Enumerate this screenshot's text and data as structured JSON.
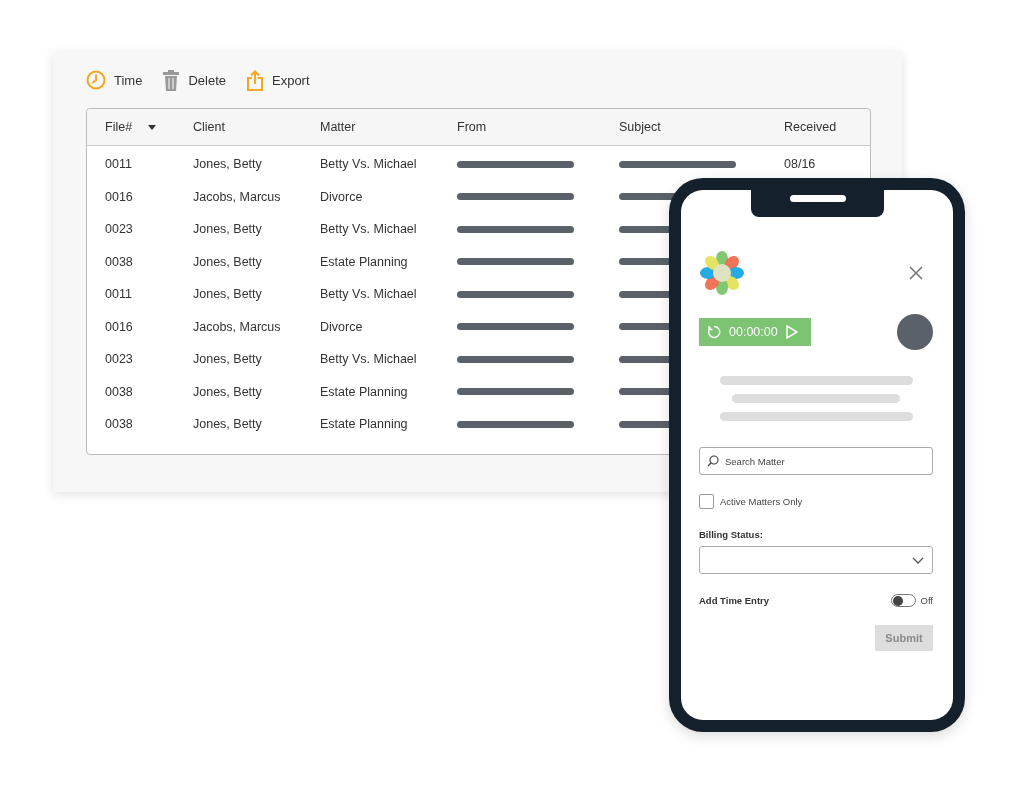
{
  "toolbar": [
    {
      "kind": "clock",
      "label": "Time"
    },
    {
      "kind": "trash",
      "label": "Delete"
    },
    {
      "kind": "export",
      "label": "Export"
    }
  ],
  "table": {
    "columns": [
      {
        "label": "File#",
        "sorted": true
      },
      {
        "label": "Client",
        "sorted": false
      },
      {
        "label": "Matter",
        "sorted": false
      },
      {
        "label": "From",
        "sorted": false
      },
      {
        "label": "Subject",
        "sorted": false
      },
      {
        "label": "Received",
        "sorted": false
      }
    ],
    "rows": [
      {
        "file": "0011",
        "client": "Jones, Betty",
        "matter": "Betty Vs. Michael",
        "received": "08/16"
      },
      {
        "file": "0016",
        "client": "Jacobs, Marcus",
        "matter": "Divorce"
      },
      {
        "file": "0023",
        "client": "Jones, Betty",
        "matter": "Betty Vs. Michael"
      },
      {
        "file": "0038",
        "client": "Jones, Betty",
        "matter": "Estate Planning"
      },
      {
        "file": "0011",
        "client": "Jones, Betty",
        "matter": "Betty Vs. Michael"
      },
      {
        "file": "0016",
        "client": "Jacobs, Marcus",
        "matter": "Divorce"
      },
      {
        "file": "0023",
        "client": "Jones, Betty",
        "matter": "Betty Vs. Michael"
      },
      {
        "file": "0038",
        "client": "Jones, Betty",
        "matter": "Estate Planning"
      },
      {
        "file": "0038",
        "client": "Jones, Betty",
        "matter": "Estate Planning"
      }
    ]
  },
  "phone": {
    "timer": "00:00:00",
    "search": {
      "placeholder": "Search Matter"
    },
    "checkbox": {
      "label": "Active Matters Only",
      "checked": false
    },
    "billing": {
      "label": "Billing Status:"
    },
    "toggle": {
      "label": "Add Time Entry",
      "on": false,
      "state_text": "Off"
    },
    "submit": {
      "label": "Submit",
      "disabled": true
    }
  }
}
